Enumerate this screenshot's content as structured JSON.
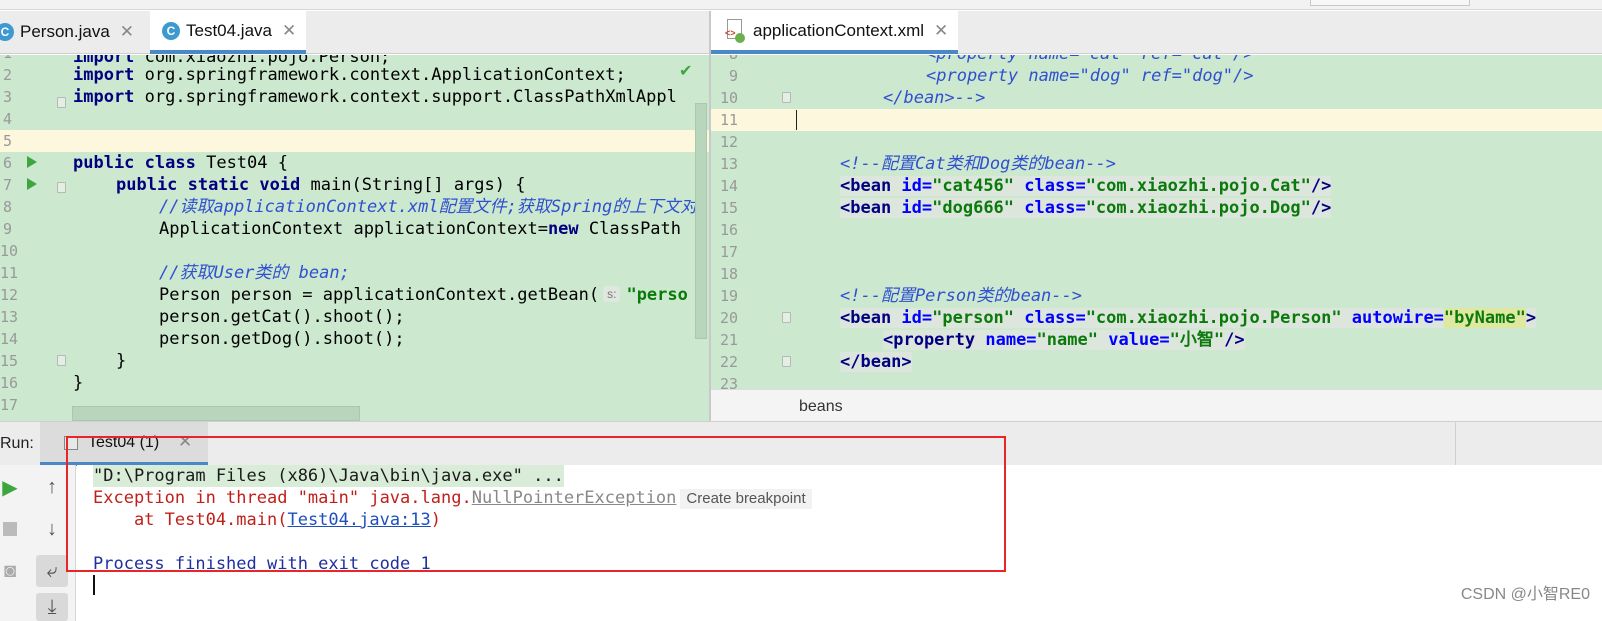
{
  "editor_left": {
    "tabs": [
      {
        "label": "Person.java",
        "icon": "class-c-icon"
      },
      {
        "label": "Test04.java",
        "icon": "class-c-icon"
      }
    ],
    "line_numbers": [
      "1",
      "2",
      "3",
      "4",
      "5",
      "6",
      "7",
      "8",
      "9",
      "10",
      "11",
      "12",
      "13",
      "14",
      "15",
      "16",
      "17"
    ],
    "code": {
      "l1_kw": "import",
      "l1_rest": " com.xiaozhi.pojo.Person;",
      "l2_kw": "import",
      "l2_rest": " org.springframework.context.ApplicationContext;",
      "l3_kw": "import",
      "l3_rest": " org.springframework.context.support.ClassPathXmlAppl",
      "l6_kw1": "public",
      "l6_kw2": "class",
      "l6_rest": " Test04 {",
      "l7_kw1": "public",
      "l7_kw2": "static",
      "l7_kw3": "void",
      "l7_rest": " main(String[] args) {",
      "l8_comment": "//读取applicationContext.xml配置文件;获取Spring的上下文对",
      "l9_a": "ApplicationContext applicationContext=",
      "l9_kw": "new",
      "l9_b": " ClassPath",
      "l11_comment": "//获取User类的 bean;",
      "l12_a": "Person person = applicationContext.getBean(",
      "l12_hint": "s:",
      "l12_str": "\"perso",
      "l13": "person.getCat().shoot();",
      "l14": "person.getDog().shoot();",
      "l15": "}",
      "l16": "}"
    }
  },
  "editor_right": {
    "tab": {
      "label": "applicationContext.xml",
      "icon": "xml-spring-icon"
    },
    "line_numbers": [
      "8",
      "9",
      "10",
      "11",
      "12",
      "13",
      "14",
      "15",
      "16",
      "17",
      "18",
      "19",
      "20",
      "21",
      "22",
      "23"
    ],
    "code": {
      "l8": "<property name=\"cat\" ref=\"cat\"/>",
      "l9": "<property name=\"dog\" ref=\"dog\"/>",
      "l10": "</bean>-->",
      "l13": "<!--配置Cat类和Dog类的bean-->",
      "l14_tag": "<bean ",
      "l14_a1": "id=",
      "l14_v1": "\"cat456\"",
      "l14_a2": " class=",
      "l14_v2": "\"com.xiaozhi.pojo.Cat\"",
      "l14_end": "/>",
      "l15_tag": "<bean ",
      "l15_a1": "id=",
      "l15_v1": "\"dog666\"",
      "l15_a2": " class=",
      "l15_v2": "\"com.xiaozhi.pojo.Dog\"",
      "l15_end": "/>",
      "l19": "<!--配置Person类的bean-->",
      "l20_tag": "<bean ",
      "l20_a1": "id=",
      "l20_v1": "\"person\"",
      "l20_a2": " class=",
      "l20_v2": "\"com.xiaozhi.pojo.Person\"",
      "l20_a3": " autowire=",
      "l20_v3": "\"byName\"",
      "l20_end": ">",
      "l21_tag": "<property ",
      "l21_a1": "name=",
      "l21_v1": "\"name\"",
      "l21_a2": " value=",
      "l21_v2": "\"小智\"",
      "l21_end": "/>",
      "l22": "</bean>"
    },
    "breadcrumb": "beans"
  },
  "run_panel": {
    "label": "Run:",
    "tab_label": "Test04 (1)",
    "console": {
      "line1": "\"D:\\Program Files (x86)\\Java\\bin\\java.exe\" ...",
      "line2_prefix": "Exception in thread \"main\" java.lang.",
      "line2_exception": "NullPointerException",
      "line2_action": "Create breakpoint",
      "line3_prefix": "    at Test04.main(",
      "line3_link": "Test04.java:13",
      "line3_suffix": ")",
      "line5": "Process finished with exit code 1"
    }
  },
  "watermark": "CSDN @小智RE0",
  "colors": {
    "editor_bg": "#cce8cf",
    "current_line": "#fdf7dd",
    "highlight_box": "#e8262a",
    "tab_underline": "#4a88c7"
  }
}
